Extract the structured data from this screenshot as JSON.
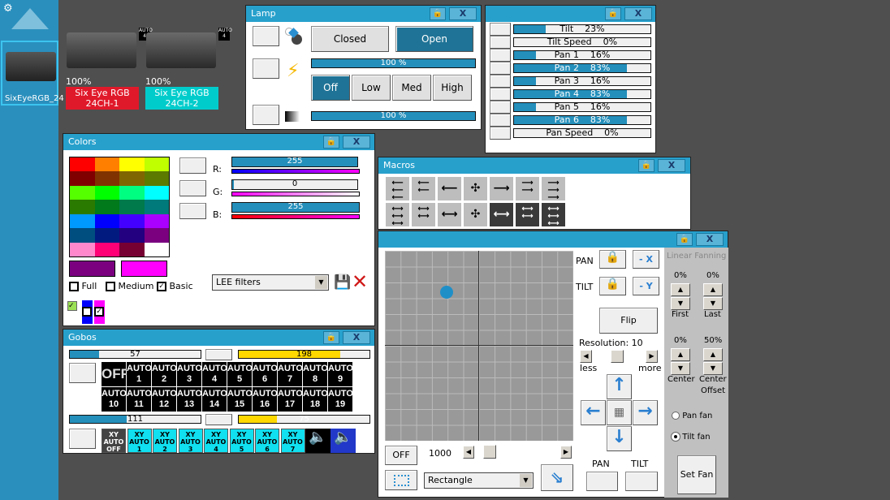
{
  "sidebar": {
    "device_label": "SixEyeRGB_24"
  },
  "fixtures": [
    {
      "percent": "100%",
      "name_line1": "Six Eye RGB",
      "name_line2": "24CH-1",
      "color": "#e0192a",
      "badge": "AUTO 4"
    },
    {
      "percent": "100%",
      "name_line1": "Six Eye RGB",
      "name_line2": "24CH-2",
      "color": "#00cccc",
      "badge": "AUTO 4"
    }
  ],
  "lamp": {
    "title": "Lamp",
    "closed": "Closed",
    "open": "Open",
    "bar1": "100 %",
    "bar1_value": 100,
    "off": "Off",
    "low": "Low",
    "med": "Med",
    "high": "High",
    "bar2": "100 %",
    "bar2_value": 100
  },
  "channels": {
    "items": [
      {
        "label": "Tilt    23%",
        "value": 23
      },
      {
        "label": "Tilt Speed    0%",
        "value": 0
      },
      {
        "label": "Pan 1    16%",
        "value": 16
      },
      {
        "label": "Pan 2    83%",
        "value": 83
      },
      {
        "label": "Pan 3    16%",
        "value": 16
      },
      {
        "label": "Pan 4    83%",
        "value": 83
      },
      {
        "label": "Pan 5    16%",
        "value": 16
      },
      {
        "label": "Pan 6    83%",
        "value": 83
      },
      {
        "label": "Pan Speed    0%",
        "value": 0
      }
    ]
  },
  "colors": {
    "title": "Colors",
    "r_label": "R:",
    "g_label": "G:",
    "b_label": "B:",
    "r_value": "255",
    "g_value": "0",
    "b_value": "255",
    "grid": [
      "#ff0000",
      "#ff8000",
      "#ffff00",
      "#bfff00",
      "#800000",
      "#803300",
      "#806600",
      "#5c7a00",
      "#55ff00",
      "#00ff00",
      "#00ff80",
      "#00ffff",
      "#2a7a00",
      "#007a1a",
      "#007a4a",
      "#007a7a",
      "#0099ff",
      "#0000ff",
      "#4400ff",
      "#aa00ff",
      "#004d80",
      "#001a80",
      "#220080",
      "#7a0080",
      "#ff88cc",
      "#ff0077",
      "#770033",
      "#ffffff"
    ],
    "preview_a": "#7a0080",
    "preview_b": "#ff00ff",
    "full": "Full",
    "medium": "Medium",
    "basic": "Basic",
    "filter": "LEE filters"
  },
  "gobos": {
    "title": "Gobos",
    "bar1": "57",
    "bar1_value": 57,
    "bar2": "198",
    "bar2_value": 198,
    "bar3": "111",
    "bar3_value": 111,
    "bar4": "75",
    "bar4_value": 75,
    "tiles": [
      "OFF",
      "AUTO 1",
      "AUTO 2",
      "AUTO 3",
      "AUTO 4",
      "AUTO 5",
      "AUTO 6",
      "AUTO 7",
      "AUTO 8",
      "AUTO 9",
      "AUTO 10",
      "AUTO 11",
      "AUTO 12",
      "AUTO 13",
      "AUTO 14",
      "AUTO 15",
      "AUTO 16",
      "AUTO 17",
      "AUTO 18",
      "AUTO 19"
    ],
    "xy_tiles": [
      "XY AUTO OFF",
      "XY AUTO 1",
      "XY AUTO 2",
      "XY AUTO 3",
      "XY AUTO 4",
      "XY AUTO 5",
      "XY AUTO 6",
      "XY AUTO 7"
    ]
  },
  "macros": {
    "title": "Macros",
    "row1": [
      "⟵⟵⟵",
      "⟵ ⟵",
      "⟵",
      "✣",
      "⟶",
      "⟶ ⟶",
      "⟶⟶⟶"
    ],
    "row2": [
      "⟷⟷⟷",
      "⟷ ⟷",
      "⟷",
      "✣",
      "⟷",
      "⟷ ⟷",
      "⟷⟷⟷"
    ]
  },
  "xy": {
    "pan": "PAN",
    "tilt": "TILT",
    "minus_x": "- X",
    "minus_y": "- Y",
    "flip": "Flip",
    "resolution": "Resolution: 10",
    "less": "less",
    "more": "more",
    "pan_bottom": "PAN",
    "tilt_bottom": "TILT",
    "off": "OFF",
    "speed": "1000",
    "shape": "Rectangle",
    "fanning": {
      "title": "Linear Fanning",
      "first_val": "0%",
      "last_val": "0%",
      "first": "First",
      "last": "Last",
      "center_val": "0%",
      "offset_val": "50%",
      "center": "Center",
      "offset1": "Center",
      "offset2": "Offset",
      "pan_fan": "Pan fan",
      "tilt_fan": "Tilt fan",
      "set_fan": "Set Fan"
    }
  }
}
